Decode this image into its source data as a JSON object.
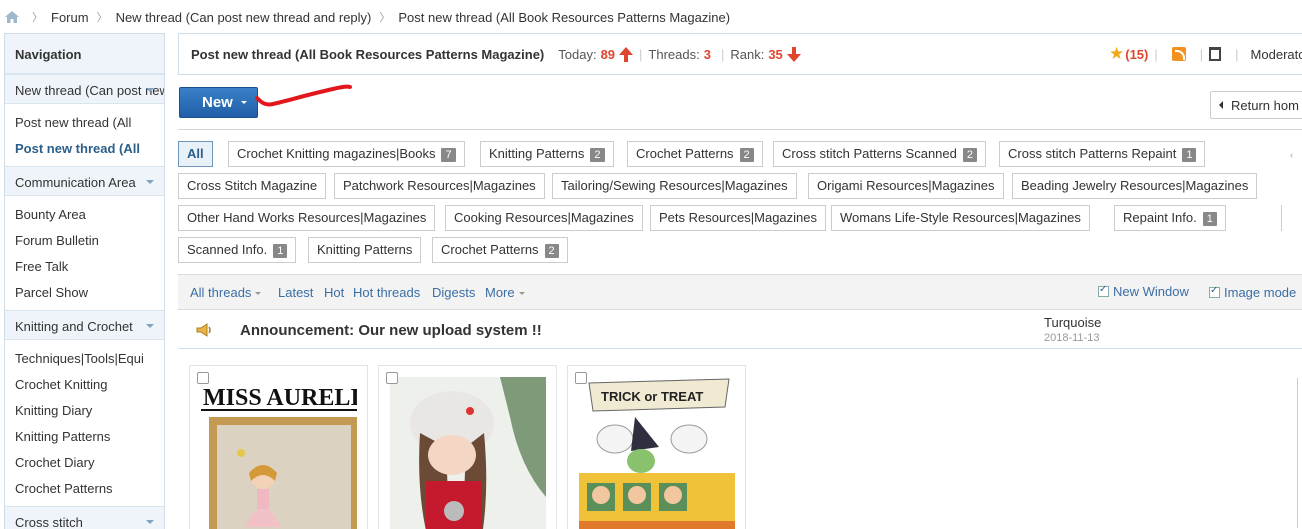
{
  "breadcrumb": {
    "items": [
      "Forum",
      "New thread (Can post new thread and reply)",
      "Post new thread (All Book Resources Patterns Magazine)"
    ]
  },
  "sidebar": {
    "heading": "Navigation",
    "groups": [
      {
        "label": "New thread (Can post new thread and reply)",
        "items": [
          "Post new thread (All",
          "Post new thread (All"
        ]
      },
      {
        "label": "Communication Area",
        "items": [
          "Bounty Area",
          "Forum Bulletin",
          "Free Talk",
          "Parcel Show"
        ]
      },
      {
        "label": "Knitting and Crochet",
        "items": [
          "Techniques|Tools|Equi",
          "Crochet Knitting",
          "Knitting Diary",
          "Knitting Patterns",
          "Crochet Diary",
          "Crochet Patterns"
        ]
      },
      {
        "label": "Cross stitch",
        "items": []
      }
    ]
  },
  "header": {
    "title": "Post new thread (All Book Resources Patterns Magazine)",
    "today_label": "Today:",
    "today_value": "89",
    "threads_label": "Threads:",
    "threads_value": "3",
    "rank_label": "Rank:",
    "rank_value": "35",
    "favorites": "(15)",
    "moderator": "Moderator C"
  },
  "toolbar": {
    "new_label": "New",
    "return_label": "Return hom"
  },
  "tags": [
    {
      "label": "All",
      "count": ""
    },
    {
      "label": "Crochet Knitting magazines|Books",
      "count": "7"
    },
    {
      "label": "Knitting Patterns",
      "count": "2"
    },
    {
      "label": "Crochet Patterns",
      "count": "2"
    },
    {
      "label": "Cross stitch Patterns Scanned",
      "count": "2"
    },
    {
      "label": "Cross stitch Patterns Repaint",
      "count": "1"
    },
    {
      "label": "Cross Stitch Magazine",
      "count": ""
    },
    {
      "label": "Patchwork Resources|Magazines",
      "count": ""
    },
    {
      "label": "Tailoring/Sewing Resources|Magazines",
      "count": ""
    },
    {
      "label": "Origami Resources|Magazines",
      "count": ""
    },
    {
      "label": "Beading Jewelry Resources|Magazines",
      "count": ""
    },
    {
      "label": "Other Hand Works Resources|Magazines",
      "count": ""
    },
    {
      "label": "Cooking Resources|Magazines",
      "count": ""
    },
    {
      "label": "Pets Resources|Magazines",
      "count": ""
    },
    {
      "label": "Womans Life-Style Resources|Magazines",
      "count": ""
    },
    {
      "label": "Repaint Info.",
      "count": "1"
    },
    {
      "label": "Scanned Info.",
      "count": "1"
    },
    {
      "label": "Knitting Patterns",
      "count": ""
    },
    {
      "label": "Crochet Patterns",
      "count": "2"
    }
  ],
  "filters": {
    "all_threads": "All threads",
    "latest": "Latest",
    "hot": "Hot",
    "hot_threads": "Hot threads",
    "digests": "Digests",
    "more": "More",
    "new_window": "New Window",
    "image_mode": "Image mode"
  },
  "announcement": {
    "title": "Announcement: Our new upload system !!",
    "author": "Turquoise",
    "date": "2018-11-13"
  },
  "cards": [
    {
      "caption": "MISS AURELI"
    },
    {
      "caption": ""
    },
    {
      "caption": "TRICK or TREAT"
    }
  ],
  "colors": {
    "accent_blue": "#2b5f8a",
    "stat_red": "#e0452e",
    "new_button": "#2568b3"
  }
}
